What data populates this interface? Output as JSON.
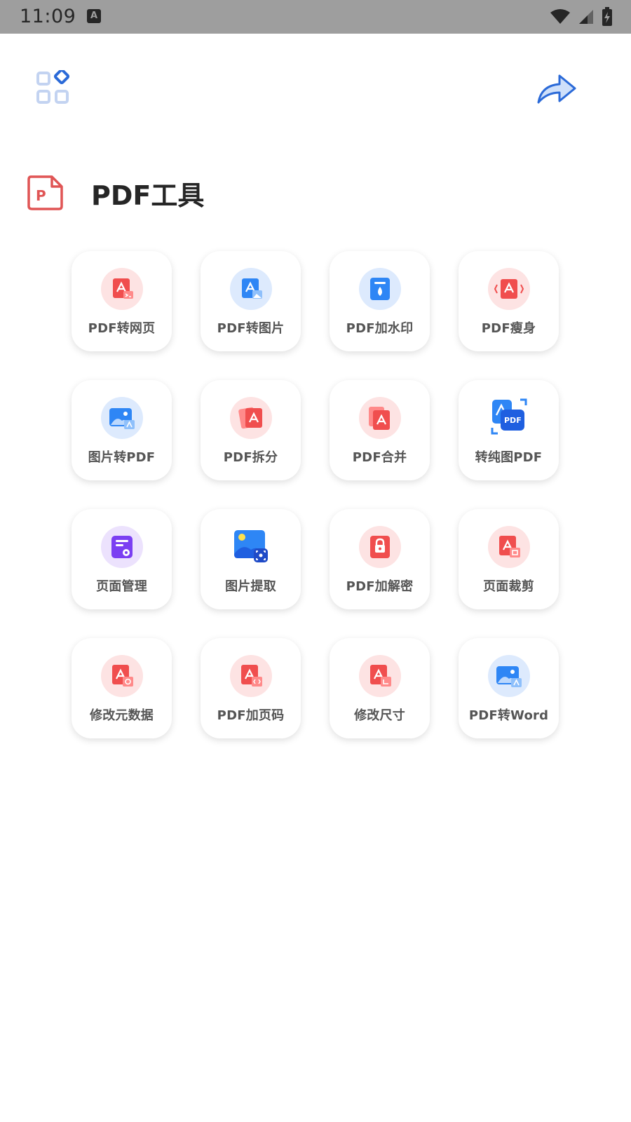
{
  "status_bar": {
    "time": "11:09",
    "notification_glyph": "A"
  },
  "header": {
    "menu_icon": "grid-apps-icon",
    "share_icon": "share-arrow-icon"
  },
  "section": {
    "title": "PDF工具",
    "logo_letter": "P"
  },
  "colors": {
    "red_accent": "#f04e4e",
    "blue_accent": "#2e86f5",
    "purple_accent": "#7b3ff2",
    "red_bg": "#fde3e3",
    "blue_bg": "#ddeafd",
    "purple_bg": "#ece2fd"
  },
  "tools": [
    {
      "label": "PDF转网页",
      "icon": "pdf-to-web-icon"
    },
    {
      "label": "PDF转图片",
      "icon": "pdf-to-image-icon"
    },
    {
      "label": "PDF加水印",
      "icon": "pdf-watermark-icon"
    },
    {
      "label": "PDF瘦身",
      "icon": "pdf-compress-icon"
    },
    {
      "label": "图片转PDF",
      "icon": "image-to-pdf-icon"
    },
    {
      "label": "PDF拆分",
      "icon": "pdf-split-icon"
    },
    {
      "label": "PDF合并",
      "icon": "pdf-merge-icon"
    },
    {
      "label": "转纯图PDF",
      "icon": "pure-image-pdf-icon"
    },
    {
      "label": "页面管理",
      "icon": "page-manage-icon"
    },
    {
      "label": "图片提取",
      "icon": "image-extract-icon"
    },
    {
      "label": "PDF加解密",
      "icon": "pdf-encrypt-icon"
    },
    {
      "label": "页面裁剪",
      "icon": "page-crop-icon"
    },
    {
      "label": "修改元数据",
      "icon": "edit-metadata-icon"
    },
    {
      "label": "PDF加页码",
      "icon": "pdf-page-number-icon"
    },
    {
      "label": "修改尺寸",
      "icon": "resize-icon"
    },
    {
      "label": "PDF转Word",
      "icon": "pdf-to-word-icon"
    }
  ]
}
